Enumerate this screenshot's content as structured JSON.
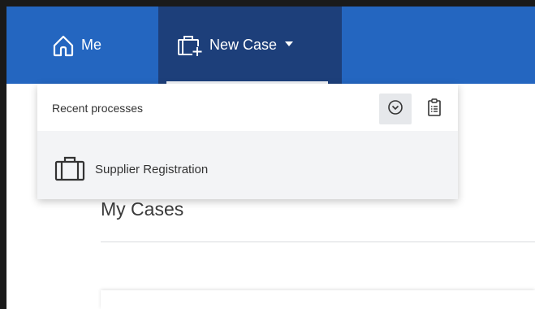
{
  "nav": {
    "me_label": "Me",
    "new_case_label": "New Case"
  },
  "recent": {
    "header": "Recent processes",
    "items": [
      {
        "label": "Supplier Registration"
      }
    ]
  },
  "main": {
    "title": "My Cases"
  }
}
